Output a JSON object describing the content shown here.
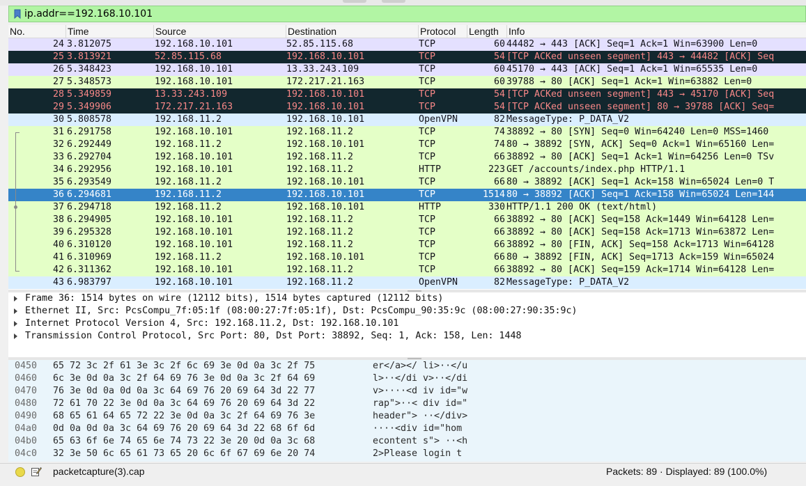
{
  "filter": {
    "value": "ip.addr==192.168.10.101"
  },
  "columns": [
    "No.",
    "Time",
    "Source",
    "Destination",
    "Protocol",
    "Length",
    "Info"
  ],
  "packets": [
    {
      "no": "24",
      "time": "3.812075",
      "src": "192.168.10.101",
      "dst": "52.85.115.68",
      "proto": "TCP",
      "len": "60",
      "info": "44482 → 443 [ACK] Seq=1 Ack=1 Win=63900 Len=0",
      "style": "lav"
    },
    {
      "no": "25",
      "time": "3.813921",
      "src": "52.85.115.68",
      "dst": "192.168.10.101",
      "proto": "TCP",
      "len": "54",
      "info": "[TCP ACKed unseen segment] 443 → 44482 [ACK] Seq",
      "style": "dark"
    },
    {
      "no": "26",
      "time": "5.348423",
      "src": "192.168.10.101",
      "dst": "13.33.243.109",
      "proto": "TCP",
      "len": "60",
      "info": "45170 → 443 [ACK] Seq=1 Ack=1 Win=65535 Len=0",
      "style": "lav"
    },
    {
      "no": "27",
      "time": "5.348573",
      "src": "192.168.10.101",
      "dst": "172.217.21.163",
      "proto": "TCP",
      "len": "60",
      "info": "39788 → 80 [ACK] Seq=1 Ack=1 Win=63882 Len=0",
      "style": "green"
    },
    {
      "no": "28",
      "time": "5.349859",
      "src": "13.33.243.109",
      "dst": "192.168.10.101",
      "proto": "TCP",
      "len": "54",
      "info": "[TCP ACKed unseen segment] 443 → 45170 [ACK] Seq",
      "style": "dark"
    },
    {
      "no": "29",
      "time": "5.349906",
      "src": "172.217.21.163",
      "dst": "192.168.10.101",
      "proto": "TCP",
      "len": "54",
      "info": "[TCP ACKed unseen segment] 80 → 39788 [ACK] Seq=",
      "style": "dark"
    },
    {
      "no": "30",
      "time": "5.808578",
      "src": "192.168.11.2",
      "dst": "192.168.10.101",
      "proto": "OpenVPN",
      "len": "82",
      "info": "MessageType: P_DATA_V2",
      "style": "blue"
    },
    {
      "no": "31",
      "time": "6.291758",
      "src": "192.168.10.101",
      "dst": "192.168.11.2",
      "proto": "TCP",
      "len": "74",
      "info": "38892 → 80 [SYN] Seq=0 Win=64240 Len=0 MSS=1460",
      "style": "green"
    },
    {
      "no": "32",
      "time": "6.292449",
      "src": "192.168.11.2",
      "dst": "192.168.10.101",
      "proto": "TCP",
      "len": "74",
      "info": "80 → 38892 [SYN, ACK] Seq=0 Ack=1 Win=65160 Len=",
      "style": "green"
    },
    {
      "no": "33",
      "time": "6.292704",
      "src": "192.168.10.101",
      "dst": "192.168.11.2",
      "proto": "TCP",
      "len": "66",
      "info": "38892 → 80 [ACK] Seq=1 Ack=1 Win=64256 Len=0 TSv",
      "style": "green"
    },
    {
      "no": "34",
      "time": "6.292956",
      "src": "192.168.10.101",
      "dst": "192.168.11.2",
      "proto": "HTTP",
      "len": "223",
      "info": "GET /accounts/index.php HTTP/1.1",
      "style": "green"
    },
    {
      "no": "35",
      "time": "6.293549",
      "src": "192.168.11.2",
      "dst": "192.168.10.101",
      "proto": "TCP",
      "len": "66",
      "info": "80 → 38892 [ACK] Seq=1 Ack=158 Win=65024 Len=0 T",
      "style": "green"
    },
    {
      "no": "36",
      "time": "6.294681",
      "src": "192.168.11.2",
      "dst": "192.168.10.101",
      "proto": "TCP",
      "len": "1514",
      "info": "80 → 38892 [ACK] Seq=1 Ack=158 Win=65024 Len=144",
      "style": "sel"
    },
    {
      "no": "37",
      "time": "6.294718",
      "src": "192.168.11.2",
      "dst": "192.168.10.101",
      "proto": "HTTP",
      "len": "330",
      "info": "HTTP/1.1 200 OK  (text/html)",
      "style": "green"
    },
    {
      "no": "38",
      "time": "6.294905",
      "src": "192.168.10.101",
      "dst": "192.168.11.2",
      "proto": "TCP",
      "len": "66",
      "info": "38892 → 80 [ACK] Seq=158 Ack=1449 Win=64128 Len=",
      "style": "green"
    },
    {
      "no": "39",
      "time": "6.295328",
      "src": "192.168.10.101",
      "dst": "192.168.11.2",
      "proto": "TCP",
      "len": "66",
      "info": "38892 → 80 [ACK] Seq=158 Ack=1713 Win=63872 Len=",
      "style": "green"
    },
    {
      "no": "40",
      "time": "6.310120",
      "src": "192.168.10.101",
      "dst": "192.168.11.2",
      "proto": "TCP",
      "len": "66",
      "info": "38892 → 80 [FIN, ACK] Seq=158 Ack=1713 Win=64128",
      "style": "green"
    },
    {
      "no": "41",
      "time": "6.310969",
      "src": "192.168.11.2",
      "dst": "192.168.10.101",
      "proto": "TCP",
      "len": "66",
      "info": "80 → 38892 [FIN, ACK] Seq=1713 Ack=159 Win=65024",
      "style": "green"
    },
    {
      "no": "42",
      "time": "6.311362",
      "src": "192.168.10.101",
      "dst": "192.168.11.2",
      "proto": "TCP",
      "len": "66",
      "info": "38892 → 80 [ACK] Seq=159 Ack=1714 Win=64128 Len=",
      "style": "green"
    },
    {
      "no": "43",
      "time": "6.983797",
      "src": "192.168.10.101",
      "dst": "192.168.11.2",
      "proto": "OpenVPN",
      "len": "82",
      "info": "MessageType: P_DATA_V2",
      "style": "blue"
    }
  ],
  "details": [
    "Frame 36: 1514 bytes on wire (12112 bits), 1514 bytes captured (12112 bits)",
    "Ethernet II, Src: PcsCompu_7f:05:1f (08:00:27:7f:05:1f), Dst: PcsCompu_90:35:9c (08:00:27:90:35:9c)",
    "Internet Protocol Version 4, Src: 192.168.11.2, Dst: 192.168.10.101",
    "Transmission Control Protocol, Src Port: 80, Dst Port: 38892, Seq: 1, Ack: 158, Len: 1448"
  ],
  "bytes": [
    {
      "off": "0450",
      "hex": "65 72 3c 2f 61 3e 3c 2f  6c 69 3e 0d 0a 3c 2f 75",
      "ascii": "er</a></ li>··</u"
    },
    {
      "off": "0460",
      "hex": "6c 3e 0d 0a 3c 2f 64 69  76 3e 0d 0a 3c 2f 64 69",
      "ascii": "l>··</di v>··</di"
    },
    {
      "off": "0470",
      "hex": "76 3e 0d 0a 0d 0a 3c 64  69 76 20 69 64 3d 22 77",
      "ascii": "v>····<d iv id=\"w"
    },
    {
      "off": "0480",
      "hex": "72 61 70 22 3e 0d 0a 3c  64 69 76 20 69 64 3d 22",
      "ascii": "rap\">··< div id=\""
    },
    {
      "off": "0490",
      "hex": "68 65 61 64 65 72 22 3e  0d 0a 3c 2f 64 69 76 3e",
      "ascii": "header\"> ··</div>"
    },
    {
      "off": "04a0",
      "hex": "0d 0a 0d 0a 3c 64 69 76  20 69 64 3d 22 68 6f 6d",
      "ascii": "····<div  id=\"hom"
    },
    {
      "off": "04b0",
      "hex": "65 63 6f 6e 74 65 6e 74  73 22 3e 20 0d 0a 3c 68",
      "ascii": "econtent s\"> ··<h"
    },
    {
      "off": "04c0",
      "hex": "32 3e 50 6c 65 61 73 65  20 6c 6f 67 69 6e 20 74",
      "ascii": "2>Please  login t"
    }
  ],
  "status": {
    "file": "packetcapture(3).cap",
    "counts": "Packets: 89 · Displayed: 89 (100.0%)"
  },
  "icons": {
    "filter": "bookmark-icon",
    "status": "status-indicator-icon",
    "comment": "edit-comment-icon"
  },
  "colors": {
    "filter_ok": "#b2f5a4",
    "selected": "#3584c8",
    "tcp_bad": "#12272e",
    "tcp_bad_text": "#f78787",
    "http_tcp": "#e4ffc7",
    "tcp_other": "#e4e0ff",
    "openvpn": "#daeeff"
  }
}
